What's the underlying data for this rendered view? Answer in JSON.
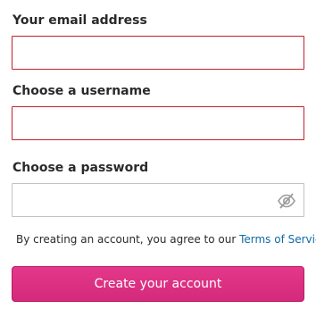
{
  "form": {
    "email": {
      "label": "Your email address",
      "value": "",
      "placeholder": ""
    },
    "username": {
      "label": "Choose a username",
      "value": "",
      "placeholder": ""
    },
    "password": {
      "label": "Choose a password",
      "value": "",
      "placeholder": "",
      "toggle_icon": "eye-slash-icon"
    },
    "terms": {
      "prefix": "By creating an account, you agree to our ",
      "link_text": "Terms of Service",
      "suffix": "."
    },
    "submit_label": "Create your account"
  },
  "colors": {
    "invalid_border": "#c31f2a",
    "button_pink": "#dc307f",
    "link_blue": "#0e6ba8"
  }
}
